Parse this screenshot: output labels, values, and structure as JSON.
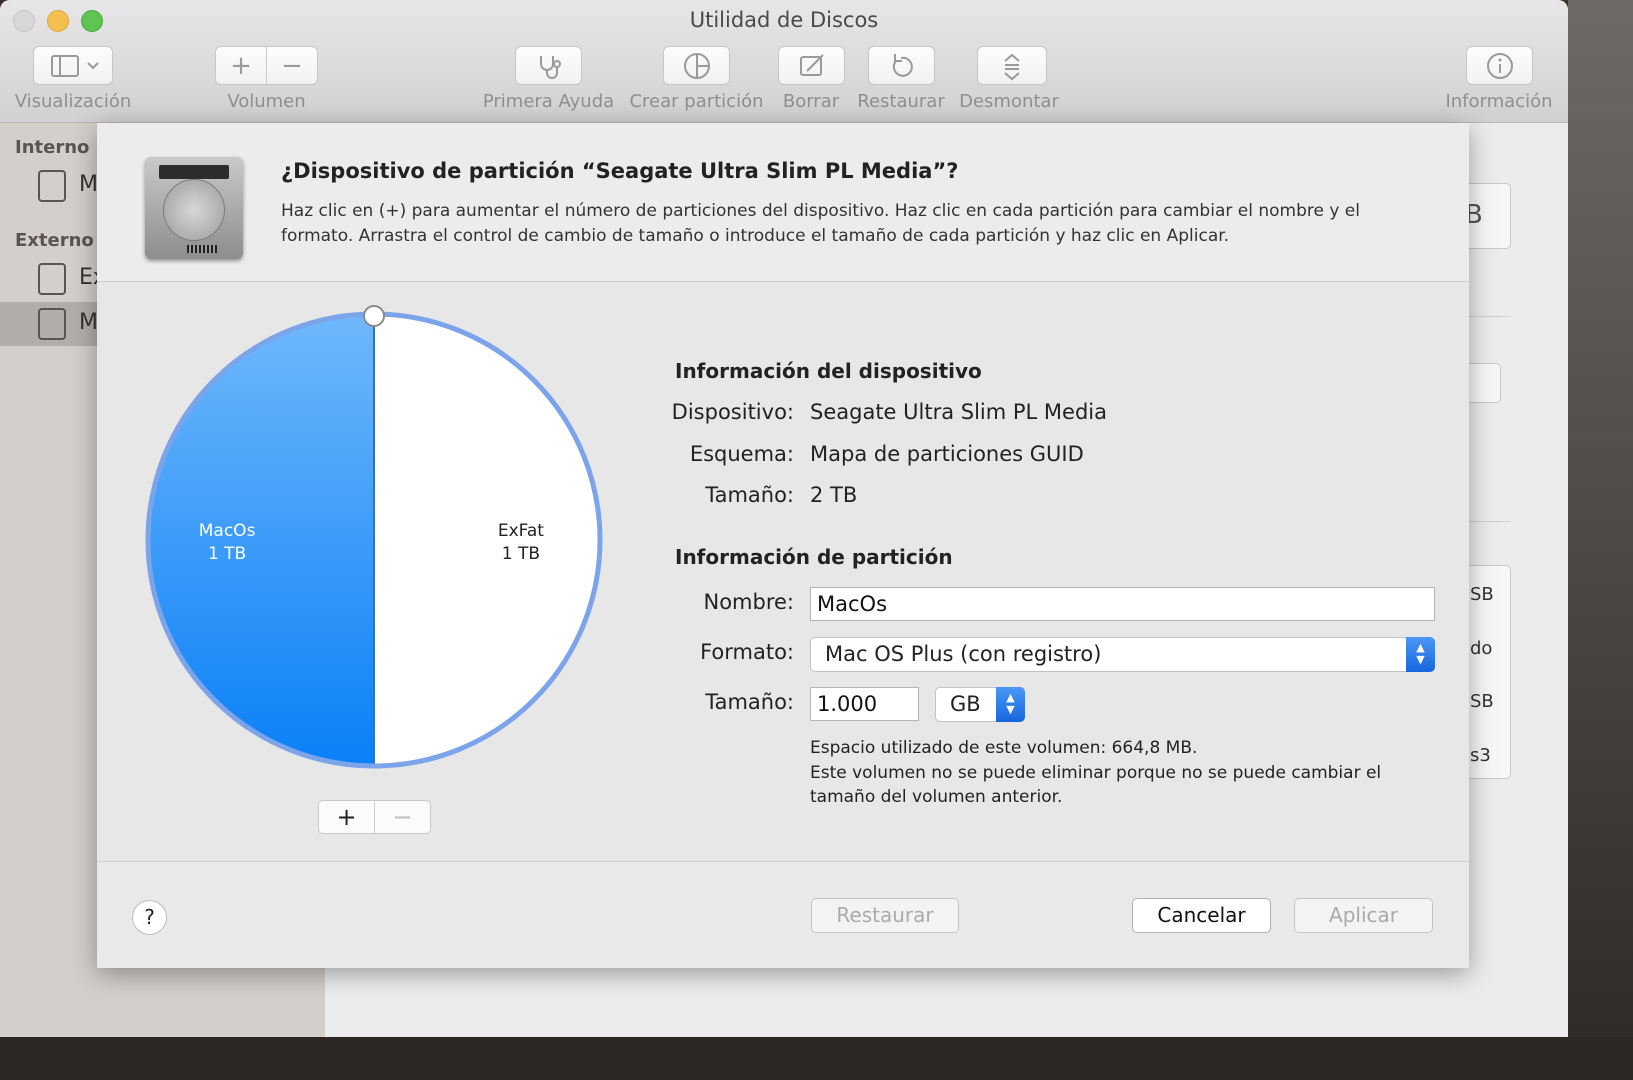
{
  "window": {
    "title": "Utilidad de Discos"
  },
  "toolbar": {
    "view_label": "Visualización",
    "volume_label": "Volumen",
    "first_aid_label": "Primera Ayuda",
    "partition_label": "Crear partición",
    "erase_label": "Borrar",
    "restore_label": "Restaurar",
    "unmount_label": "Desmontar",
    "info_label": "Información",
    "plus": "+",
    "minus": "−"
  },
  "sidebar": {
    "internal_header": "Interno",
    "external_header": "Externo",
    "items": [
      {
        "label": "M"
      },
      {
        "label": "Ex"
      },
      {
        "label": "M"
      }
    ]
  },
  "background_main": {
    "fragments": [
      "B",
      "SB",
      "do",
      "SB",
      "s3"
    ]
  },
  "sheet": {
    "title": "¿Dispositivo de partición “Seagate Ultra Slim PL Media”?",
    "description": "Haz clic en (+) para aumentar el número de particiones del dispositivo. Haz clic en cada partición para cambiar el nombre y el formato. Arrastra el control de cambio de tamaño o introduce el tamaño de cada partición y haz clic en Aplicar.",
    "device_info": {
      "header": "Información del dispositivo",
      "device_label": "Dispositivo:",
      "device_value": "Seagate Ultra Slim PL Media",
      "scheme_label": "Esquema:",
      "scheme_value": "Mapa de particiones GUID",
      "size_label": "Tamaño:",
      "size_value": "2 TB"
    },
    "partition_info": {
      "header": "Información de partición",
      "name_label": "Nombre:",
      "name_value": "MacOs",
      "format_label": "Formato:",
      "format_value": "Mac OS Plus (con registro)",
      "size_label": "Tamaño:",
      "size_value": "1.000",
      "unit_value": "GB",
      "note_line1": "Espacio utilizado de este volumen: 664,8 MB.",
      "note_line2": "Este volumen no se puede eliminar porque no se puede cambiar el tamaño del volumen anterior."
    },
    "pie_controls": {
      "add": "+",
      "remove": "−"
    },
    "buttons": {
      "help": "?",
      "restore": "Restaurar",
      "cancel": "Cancelar",
      "apply": "Aplicar"
    }
  },
  "chart_data": {
    "type": "pie",
    "slices": [
      {
        "name": "MacOs",
        "label": "1 TB",
        "value": 1,
        "color": "#2f93f4"
      },
      {
        "name": "ExFat",
        "label": "1 TB",
        "value": 1,
        "color": "#ffffff"
      }
    ]
  },
  "colors": {
    "accent": "#1a7cf0",
    "ring": "#7ca4ea"
  }
}
